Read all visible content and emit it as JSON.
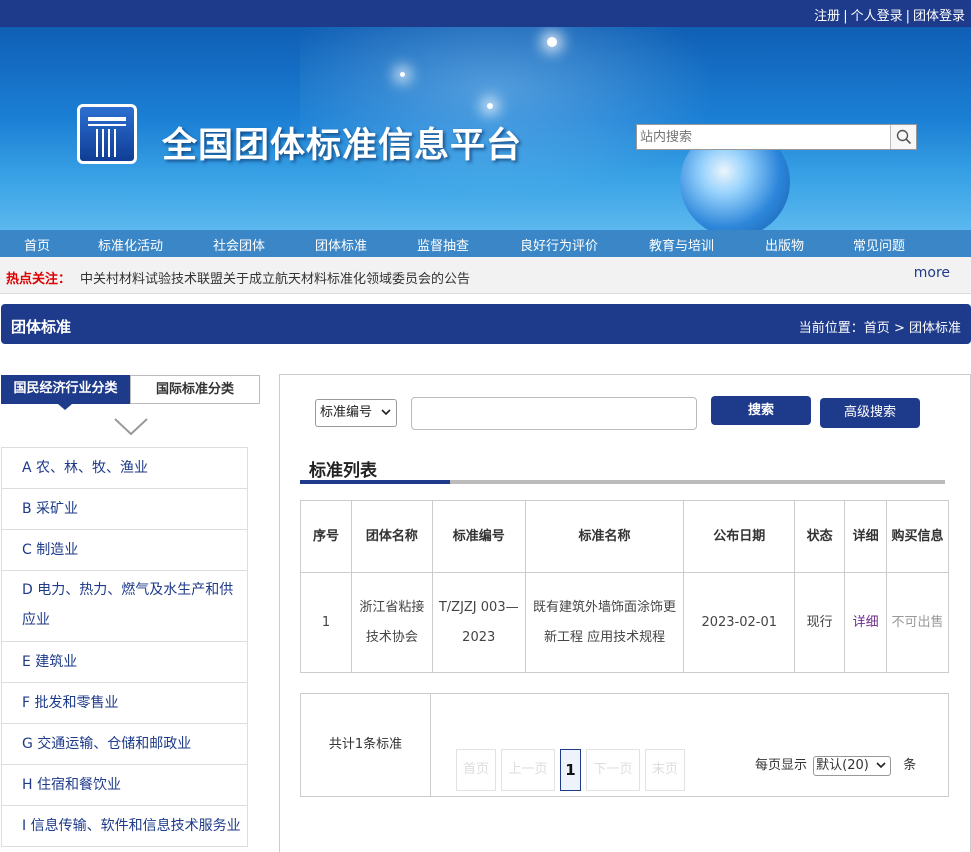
{
  "top_links": [
    "注册",
    "个人登录",
    "团体登录"
  ],
  "site_title": "全国团体标准信息平台",
  "search": {
    "placeholder": "站内搜索"
  },
  "nav": [
    "首页",
    "标准化活动",
    "社会团体",
    "团体标准",
    "监督抽查",
    "良好行为评价",
    "教育与培训",
    "出版物",
    "常见问题"
  ],
  "hot": {
    "label": "热点关注：",
    "text": "中关村材料试验技术联盟关于成立航天材料标准化领域委员会的公告",
    "more": "more"
  },
  "section": {
    "title": "团体标准",
    "crumb_prefix": "当前位置：",
    "crumb_home": "首页",
    "crumb_sep": ">",
    "crumb_current": "团体标准"
  },
  "left_tabs": {
    "active": "国民经济行业分类",
    "inactive": "国际标准分类"
  },
  "categories": [
    "A 农、林、牧、渔业",
    "B 采矿业",
    "C 制造业",
    "D 电力、热力、燃气及水生产和供应业",
    "E 建筑业",
    "F 批发和零售业",
    "G 交通运输、仓储和邮政业",
    "H 住宿和餐饮业",
    "I 信息传输、软件和信息技术服务业"
  ],
  "search_form": {
    "field_select": "标准编号",
    "search_btn": "搜索",
    "adv_btn": "高级搜索"
  },
  "list": {
    "title": "标准列表",
    "headers": [
      "序号",
      "团体名称",
      "标准编号",
      "标准名称",
      "公布日期",
      "状态",
      "详细",
      "购买信息"
    ],
    "rows": [
      {
        "no": "1",
        "org": "浙江省粘接技术协会",
        "code": "T/ZJZJ 003—2023",
        "name": "既有建筑外墙饰面涂饰更新工程 应用技术规程",
        "date": "2023-02-01",
        "status": "现行",
        "detail": "详细",
        "buy": "不可出售"
      }
    ]
  },
  "pager": {
    "total": "共计1条标准",
    "first": "首页",
    "prev": "上一页",
    "current": "1",
    "next": "下一页",
    "last": "末页",
    "per_page_label": "每页显示",
    "per_page_value": "默认(20)",
    "unit": "条"
  },
  "colors": {
    "primary": "#1e3a8a",
    "nav": "#3b86c7",
    "hot_label": "#dd0000"
  }
}
